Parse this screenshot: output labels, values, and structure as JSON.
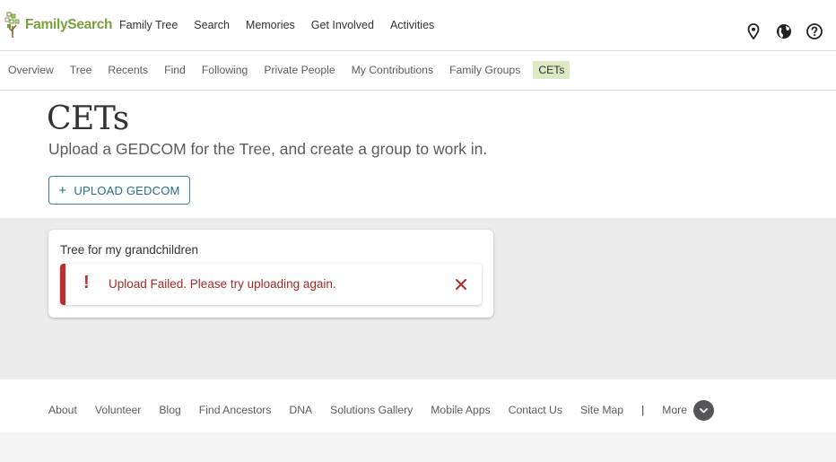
{
  "header": {
    "logo_text": "FamilySearch",
    "nav": [
      "Family Tree",
      "Search",
      "Memories",
      "Get Involved",
      "Activities"
    ],
    "icons": [
      "location-pin-icon",
      "globe-icon",
      "help-icon"
    ]
  },
  "subnav": {
    "items": [
      "Overview",
      "Tree",
      "Recents",
      "Find",
      "Following",
      "Private People",
      "My Contributions",
      "Family Groups",
      "CETs"
    ],
    "active": "CETs"
  },
  "page": {
    "title": "CETs",
    "subtitle": "Upload a GEDCOM for the Tree, and create a group to work in.",
    "upload_label": "UPLOAD GEDCOM"
  },
  "tree_card": {
    "name": "Tree for my grandchildren",
    "error_message": "Upload Failed. Please try uploading again.",
    "error_icon_glyph": "!"
  },
  "footer": {
    "links": [
      "About",
      "Volunteer",
      "Blog",
      "Find Ancestors",
      "DNA",
      "Solutions Gallery",
      "Mobile Apps",
      "Contact Us",
      "Site Map"
    ],
    "separator": "|",
    "more_label": "More"
  },
  "colors": {
    "brand_green": "#7aa03b",
    "active_tab_bg": "#dde9c4",
    "button_teal": "#24707e",
    "error_red": "#c02c2c",
    "content_bg": "#ececec"
  }
}
